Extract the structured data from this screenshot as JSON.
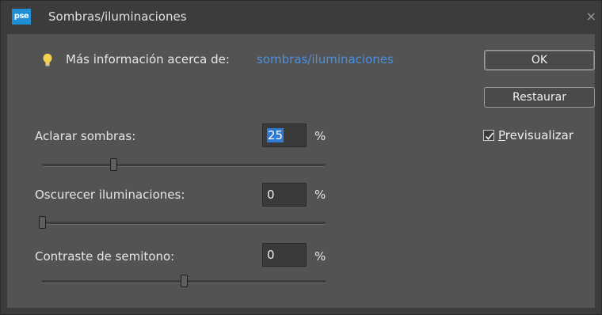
{
  "window": {
    "title": "Sombras/iluminaciones",
    "app_icon": "pse",
    "close_glyph": "×"
  },
  "info": {
    "label": "Más información acerca de:",
    "link": "sombras/iluminaciones",
    "icon": "lightbulb-icon"
  },
  "buttons": {
    "ok": "OK",
    "reset": "Restaurar"
  },
  "preview": {
    "accel": "P",
    "rest": "revisualizar",
    "checked": true
  },
  "controls": [
    {
      "label": "Aclarar sombras:",
      "value": "25",
      "unit": "%",
      "level": 0.25
    },
    {
      "label": "Oscurecer iluminaciones:",
      "value": "0",
      "unit": "%",
      "level": 0
    },
    {
      "label": "Contraste de semitono:",
      "value": "0",
      "unit": "%",
      "level": 0.5
    }
  ],
  "colors": {
    "link": "#4a90e2",
    "selection": "#2f7bd1",
    "app_icon_bg": "#1e8fd6"
  }
}
